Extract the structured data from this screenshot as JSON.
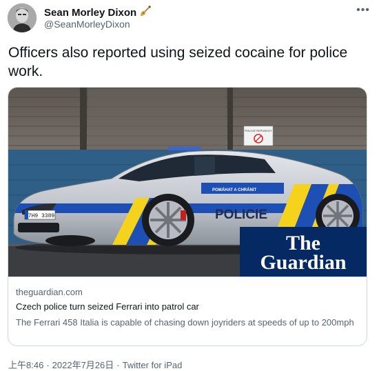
{
  "author": {
    "display_name": "Sean Morley Dixon",
    "handle": "@SeanMorleyDixon",
    "badge_icon": "guitar-icon"
  },
  "tweet": {
    "text": "Officers also reported using seized cocaine for police work."
  },
  "card": {
    "domain": "theguardian.com",
    "title": "Czech police turn seized Ferrari into patrol car",
    "description": "The Ferrari 458 Italia is capable of chasing down joyriders at speeds of up to 200mph",
    "image": {
      "car_label": "POLICIE",
      "car_slogan": "POMÁHAT A CHRÁNIT",
      "plate": "7H9 3389",
      "sign_text": "POLICIE REPUBLIKY",
      "logo_line1": "The",
      "logo_line2": "Guardian",
      "logo_bg": "#052962"
    }
  },
  "footer": {
    "time": "上午8:46",
    "date": "2022年7月26日",
    "source": "Twitter for iPad",
    "separator": "·"
  },
  "colors": {
    "text": "#0f1419",
    "secondary": "#536471",
    "border": "#cfd9de",
    "police_blue": "#1d4fb5",
    "police_yellow": "#f5d21b"
  }
}
